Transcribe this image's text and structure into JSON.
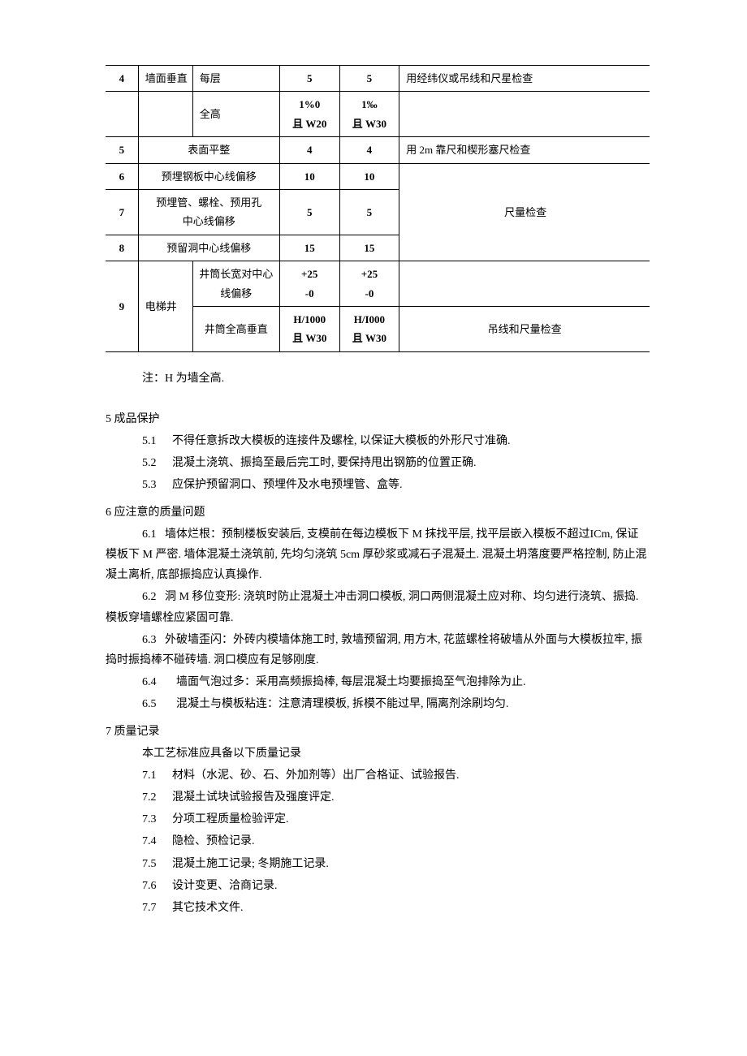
{
  "table": {
    "rows": [
      {
        "idx": "4",
        "item1": "墙面垂直",
        "item2": "每层",
        "val1": "5",
        "val2": "5",
        "method": "用经纬仪或吊线和尺星检查"
      },
      {
        "idx": "",
        "item1": "",
        "item2": "全高",
        "val1_line1": "1%0",
        "val1_line2": "且 W20",
        "val2_line1": "1‰",
        "val2_line2": "且 W30",
        "method": ""
      },
      {
        "idx": "5",
        "item": "表面平整",
        "val1": "4",
        "val2": "4",
        "method": "用 2m 靠尺和楔形塞尺检查"
      },
      {
        "idx": "6",
        "item": "预埋钢板中心线偏移",
        "val1": "10",
        "val2": "10"
      },
      {
        "idx": "7",
        "item_line1": "预埋管、螺栓、预用孔",
        "item_line2": "中心线偏移",
        "val1": "5",
        "val2": "5",
        "method": "尺量检查"
      },
      {
        "idx": "8",
        "item": "预留洞中心线偏移",
        "val1": "15",
        "val2": "15"
      },
      {
        "idx": "9",
        "item1": "电梯井",
        "item2_line1": "井筒长宽对中心",
        "item2_line2": "线偏移",
        "val1_line1": "+25",
        "val1_line2": "-0",
        "val2_line1": "+25",
        "val2_line2": "-0"
      },
      {
        "item2": "井筒全高垂直",
        "val1_line1": "H/1000",
        "val1_line2": "且 W30",
        "val2_line1": "H/I000",
        "val2_line2": "且 W30",
        "method": "吊线和尺量检查"
      }
    ]
  },
  "note": "注：H 为墙全高.",
  "sections": [
    {
      "heading": "5 成品保护",
      "items": [
        {
          "num": "5.1",
          "text": "不得任意拆改大模板的连接件及螺栓, 以保证大模板的外形尺寸准确."
        },
        {
          "num": "5.2",
          "text": "混凝土浇筑、振捣至最后完工时, 要保持甩出钢筋的位置正确."
        },
        {
          "num": "5.3",
          "text": "应保护预留洞口、预埋件及水电预埋管、盒等."
        }
      ]
    },
    {
      "heading": "6 应注意的质量问题",
      "paras": [
        {
          "num": "6.1",
          "text": "墙体烂根：预制楼板安装后, 支模前在每边模板下 M 抹找平层, 找平层嵌入模板不超过ICm, 保证模板下 M 严密. 墙体混凝土浇筑前, 先均匀浇筑 5cm 厚砂浆或减石子混凝土. 混凝土坍落度要严格控制, 防止混凝土离析, 底部振捣应认真操作."
        },
        {
          "num": "6.2",
          "text": "洞 M 移位变形:  浇筑时防止混凝土冲击洞口模板, 洞口两侧混凝土应对称、均匀进行浇筑、振捣. 模板穿墙螺栓应紧固可靠."
        },
        {
          "num": "6.3",
          "text": "外破墙歪闪：外砖内模墙体施工时, 敦墙预留洞, 用方木, 花蓝螺栓将破墙从外面与大模板拉牢, 振捣时振捣棒不碰砖墙. 洞口模应有足够刚度."
        },
        {
          "num": "6.4",
          "text": "墙面气泡过多：采用高频振捣棒, 每层混凝土均要振捣至气泡排除为止."
        },
        {
          "num": "6.5",
          "text": "混凝土与模板粘连：注意清理模板, 拆模不能过早, 隔离剂涂刷均匀."
        }
      ]
    },
    {
      "heading": "7 质量记录",
      "intro": "本工艺标准应具备以下质量记录",
      "items": [
        {
          "num": "7.1",
          "text": "材料（水泥、砂、石、外加剂等）出厂合格证、试验报告."
        },
        {
          "num": "7.2",
          "text": "混凝土试块试验报告及强度评定."
        },
        {
          "num": "7.3",
          "text": "分项工程质量检验评定."
        },
        {
          "num": "7.4",
          "text": "隐检、预检记录."
        },
        {
          "num": "7.5",
          "text": "混凝土施工记录; 冬期施工记录."
        },
        {
          "num": "7.6",
          "text": "设计变更、洽商记录."
        },
        {
          "num": "7.7",
          "text": "其它技术文件."
        }
      ]
    }
  ]
}
